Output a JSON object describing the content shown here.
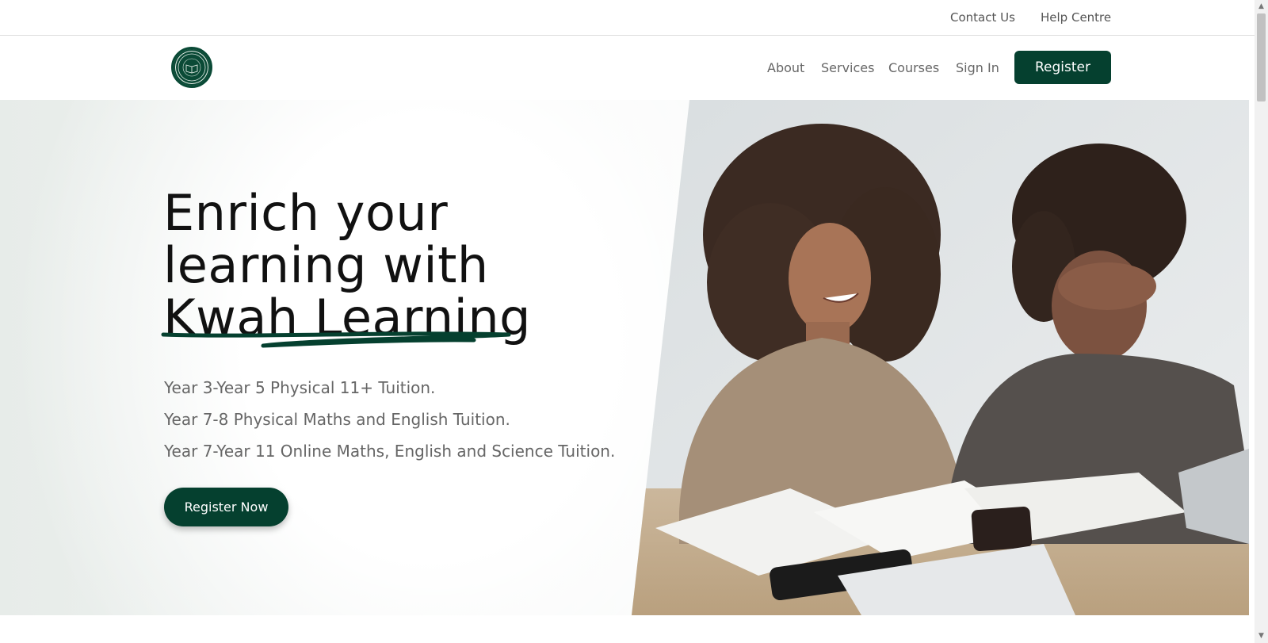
{
  "topbar": {
    "contact_label": "Contact Us",
    "help_label": "Help Centre"
  },
  "nav": {
    "items": [
      {
        "label": "About"
      },
      {
        "label": "Services"
      },
      {
        "label": "Courses"
      },
      {
        "label": "Sign In"
      }
    ],
    "register_label": "Register"
  },
  "hero": {
    "title_line1": "Enrich your",
    "title_line2": "learning with",
    "title_line3": "Kwah Learning",
    "lines": [
      "Year 3-Year 5 Physical 11+ Tuition.",
      "Year 7-8 Physical Maths and English Tuition.",
      "Year 7-Year 11 Online Maths, English and Science Tuition."
    ],
    "cta_label": "Register Now"
  },
  "colors": {
    "brand": "#05402f",
    "text_muted": "#666666"
  },
  "icons": {
    "logo": "book-seal-logo",
    "scroll_up": "chevron-up-icon",
    "scroll_down": "chevron-down-icon"
  }
}
